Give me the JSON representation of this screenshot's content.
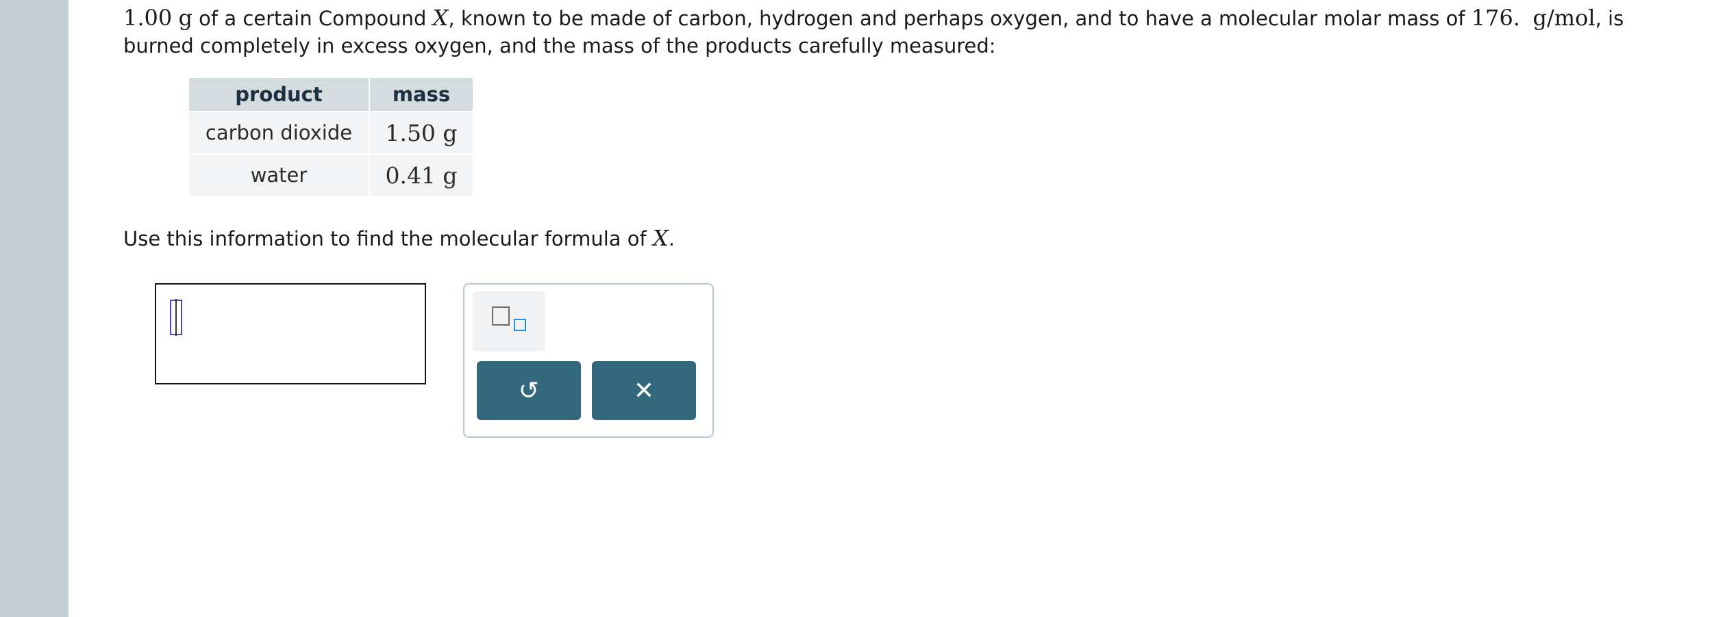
{
  "problem": {
    "mass_value": "1.00",
    "mass_unit": "g",
    "text_part1": " of a certain Compound ",
    "compound_var": "X",
    "text_part2": ", known to be made of carbon, hydrogen and perhaps oxygen, and to have a molecular molar mass of ",
    "molar_mass_value": "176.",
    "molar_mass_unit": "g/mol",
    "text_part3": ", is burned completely in excess oxygen, and the mass of the products carefully measured:"
  },
  "table": {
    "headers": [
      "product",
      "mass"
    ],
    "rows": [
      {
        "product": "carbon dioxide",
        "mass": "1.50 g"
      },
      {
        "product": "water",
        "mass": "0.41 g"
      }
    ]
  },
  "question": {
    "text": "Use this information to find the molecular formula of ",
    "var": "X",
    "end": "."
  },
  "palette": {
    "subscript_icon": "subscript-template-icon",
    "undo_symbol": "↺",
    "clear_symbol": "✕"
  },
  "colors": {
    "rail": "#c4cfd3",
    "button": "#33687d",
    "table_header": "#d4dce0",
    "table_cell": "#f2f3f4"
  }
}
